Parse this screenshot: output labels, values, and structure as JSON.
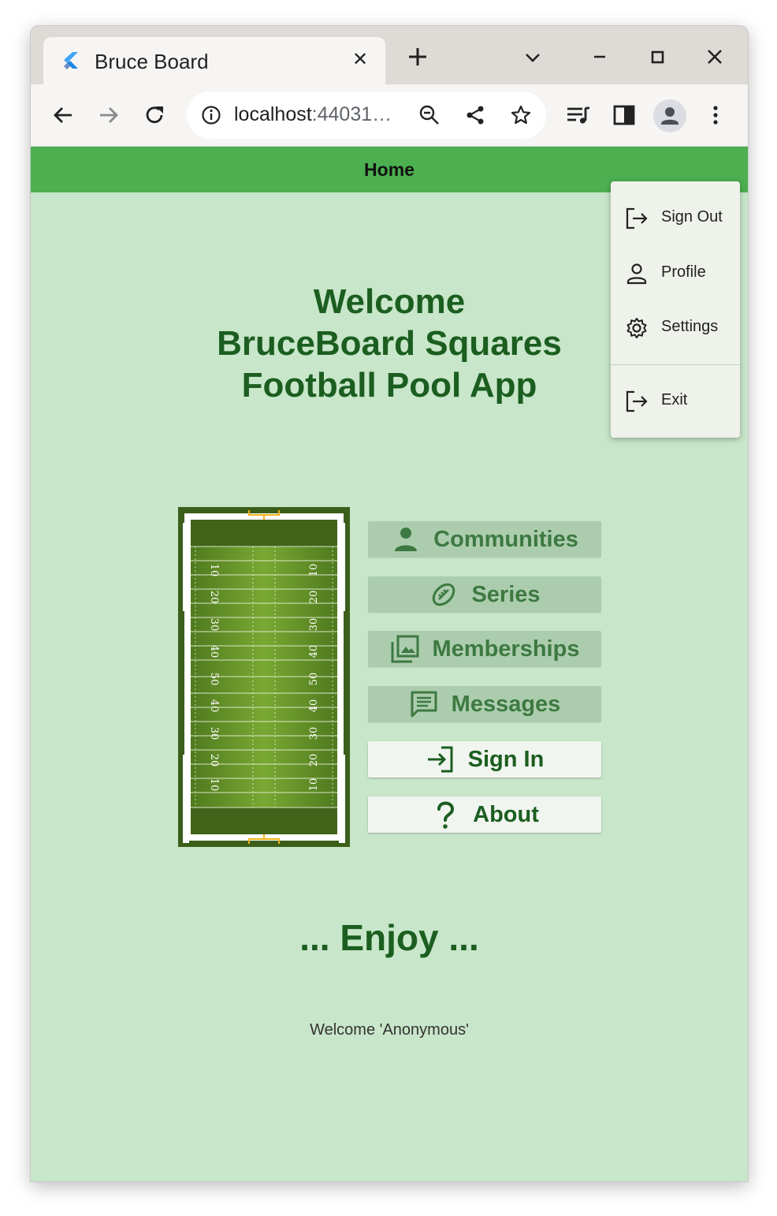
{
  "browser": {
    "tab": {
      "title": "Bruce Board",
      "favicon": "flutter-icon",
      "close": "✕"
    },
    "new_tab": "plus-icon",
    "url": {
      "host": "localhost",
      "rest": ":44031…"
    },
    "icons": [
      "back-icon",
      "forward-icon",
      "reload-icon",
      "info-icon",
      "zoom-out-icon",
      "share-icon",
      "bookmark-star-icon",
      "media-queue-icon",
      "side-panel-icon",
      "profile-avatar-icon",
      "kebab-menu-icon"
    ]
  },
  "app": {
    "appbar_title": "Home",
    "welcome_lines": [
      "Welcome",
      "BruceBoard Squares",
      "Football Pool App"
    ],
    "nav_buttons": [
      {
        "label": "Communities",
        "icon": "person-icon",
        "style": "dim"
      },
      {
        "label": "Series",
        "icon": "football-icon",
        "style": "dim"
      },
      {
        "label": "Memberships",
        "icon": "photo-library-icon",
        "style": "dim"
      },
      {
        "label": "Messages",
        "icon": "message-icon",
        "style": "dim"
      },
      {
        "label": "Sign In",
        "icon": "login-icon",
        "style": "light"
      },
      {
        "label": "About",
        "icon": "question-icon",
        "style": "light"
      }
    ],
    "enjoy": "... Enjoy ...",
    "welcome_user": "Welcome 'Anonymous'",
    "field_yard_labels": [
      "10",
      "20",
      "30",
      "40",
      "50",
      "40",
      "30",
      "20",
      "10"
    ]
  },
  "menu": {
    "items": [
      {
        "label": "Sign Out",
        "icon": "logout-icon"
      },
      {
        "label": "Profile",
        "icon": "person-outline-icon"
      },
      {
        "label": "Settings",
        "icon": "gear-icon"
      },
      {
        "label": "Exit",
        "icon": "exit-icon"
      }
    ]
  },
  "colors": {
    "appbar": "#4caf50",
    "page_bg": "#c8e6c9",
    "title_text": "#1b5e20"
  }
}
